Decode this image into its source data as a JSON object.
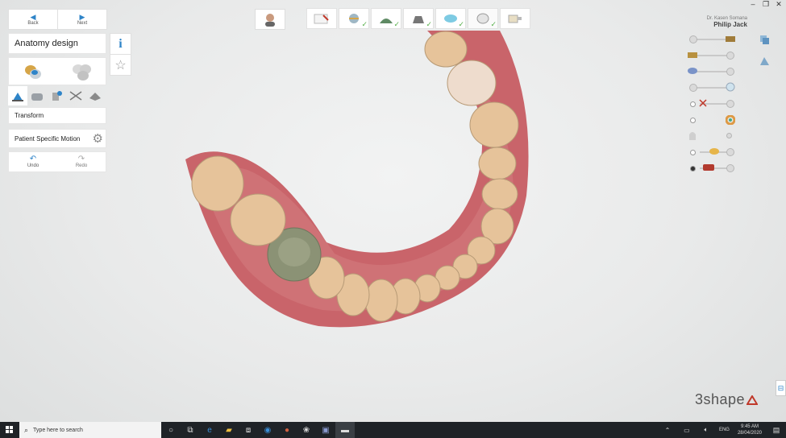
{
  "nav": {
    "back_label": "Back",
    "next_label": "Next"
  },
  "sidebar": {
    "title": "Anatomy design",
    "transform_label": "Transform",
    "psm_label": "Patient Specific Motion",
    "undo_label": "Undo",
    "redo_label": "Redo"
  },
  "header": {
    "doctor": "Dr. Kasen Somana",
    "patient": "Philip Jack"
  },
  "brand": {
    "logo_text": "3shape"
  },
  "taskbar": {
    "search_placeholder": "Type here to search",
    "lang": "ENG",
    "time": "9:45 AM",
    "date": "28/04/2020"
  },
  "colors": {
    "accent": "#2e84c8",
    "check": "#56b04a",
    "brand": "#c0392b",
    "gum": "#c9646a",
    "tooth": "#e6c39a",
    "crown": "#8b9275"
  }
}
